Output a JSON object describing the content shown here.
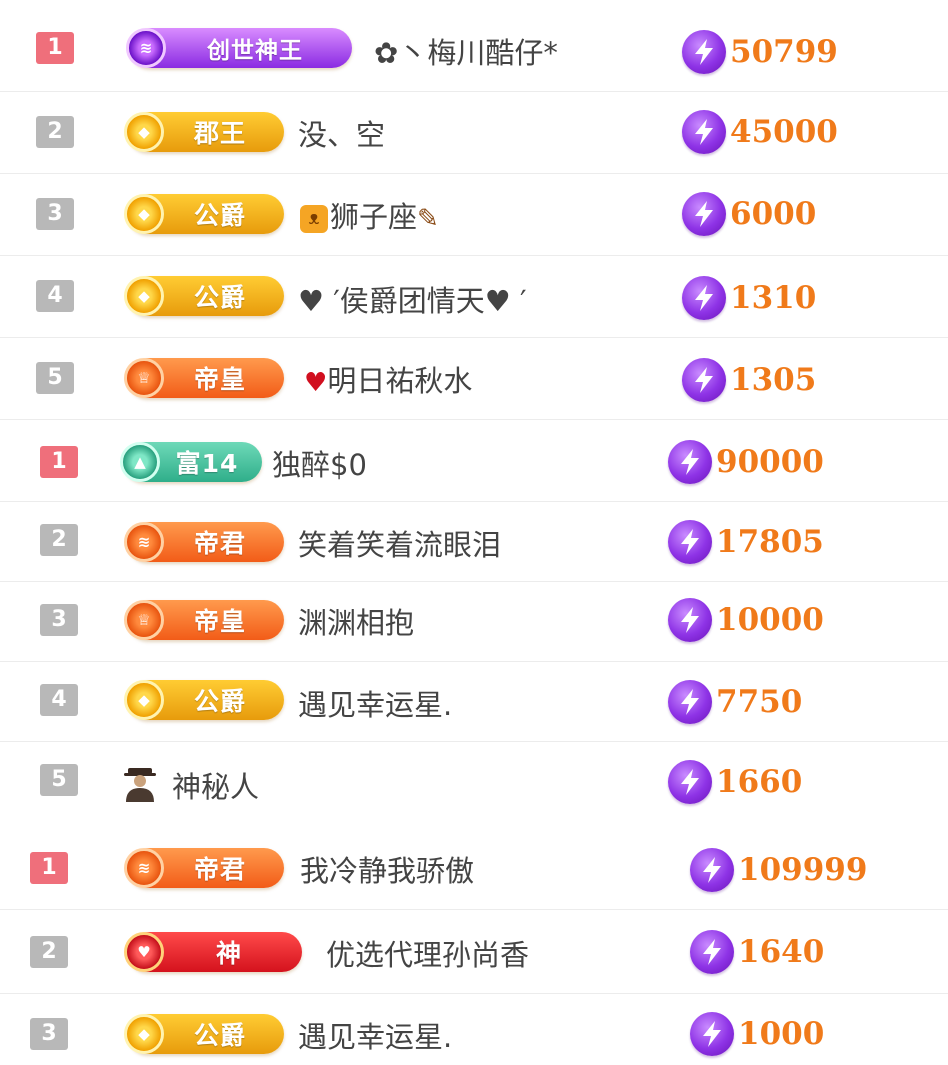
{
  "colors": {
    "rank_first": "#ef6f7b",
    "rank_other": "#b8b8b8",
    "score": "#f07a1a",
    "bolt": "#8e33e6"
  },
  "sections": [
    {
      "rows": [
        {
          "rank": "1",
          "badge": {
            "label": "创世神王",
            "style": "purple",
            "icon": "crown-emblem-icon"
          },
          "prefix": "✿丶",
          "name": "梅川酷仔*",
          "score": "50799"
        },
        {
          "rank": "2",
          "badge": {
            "label": "郡王",
            "style": "gold",
            "icon": "diamond-emblem-icon"
          },
          "name": "没、空",
          "score": "45000"
        },
        {
          "rank": "3",
          "badge": {
            "label": "公爵",
            "style": "gold",
            "icon": "diamond-emblem-icon"
          },
          "name": "狮子座",
          "score": "6000"
        },
        {
          "rank": "4",
          "badge": {
            "label": "公爵",
            "style": "gold",
            "icon": "diamond-emblem-icon"
          },
          "name": "♥ ′侯爵团情天♥ ′",
          "score": "1310"
        },
        {
          "rank": "5",
          "badge": {
            "label": "帝皇",
            "style": "orange",
            "icon": "crown-emblem-icon"
          },
          "name": "明日祐秋水",
          "score": "1305"
        }
      ]
    },
    {
      "rows": [
        {
          "rank": "1",
          "badge": {
            "label": "富14",
            "style": "teal",
            "icon": "tree-emblem-icon"
          },
          "name": "独醉$0",
          "score": "90000"
        },
        {
          "rank": "2",
          "badge": {
            "label": "帝君",
            "style": "orange",
            "icon": "crown-emblem-icon"
          },
          "name": "笑着笑着流眼泪",
          "score": "17805"
        },
        {
          "rank": "3",
          "badge": {
            "label": "帝皇",
            "style": "orange",
            "icon": "crown-emblem-icon"
          },
          "name": "渊渊相抱",
          "score": "10000"
        },
        {
          "rank": "4",
          "badge": {
            "label": "公爵",
            "style": "gold",
            "icon": "diamond-emblem-icon"
          },
          "name": "遇见幸运星.",
          "score": "7750"
        },
        {
          "rank": "5",
          "avatar": "mystery-person-icon",
          "name": "神秘人",
          "score": "1660"
        }
      ]
    },
    {
      "rows": [
        {
          "rank": "1",
          "badge": {
            "label": "帝君",
            "style": "orange",
            "icon": "crown-emblem-icon"
          },
          "name": "我冷静我骄傲",
          "score": "109999"
        },
        {
          "rank": "2",
          "badge": {
            "label": "神",
            "style": "red",
            "icon": "heart-emblem-icon"
          },
          "name": "优选代理孙尚香",
          "score": "1640"
        },
        {
          "rank": "3",
          "badge": {
            "label": "公爵",
            "style": "gold",
            "icon": "diamond-emblem-icon"
          },
          "name": "遇见幸运星.",
          "score": "1000"
        }
      ]
    }
  ]
}
